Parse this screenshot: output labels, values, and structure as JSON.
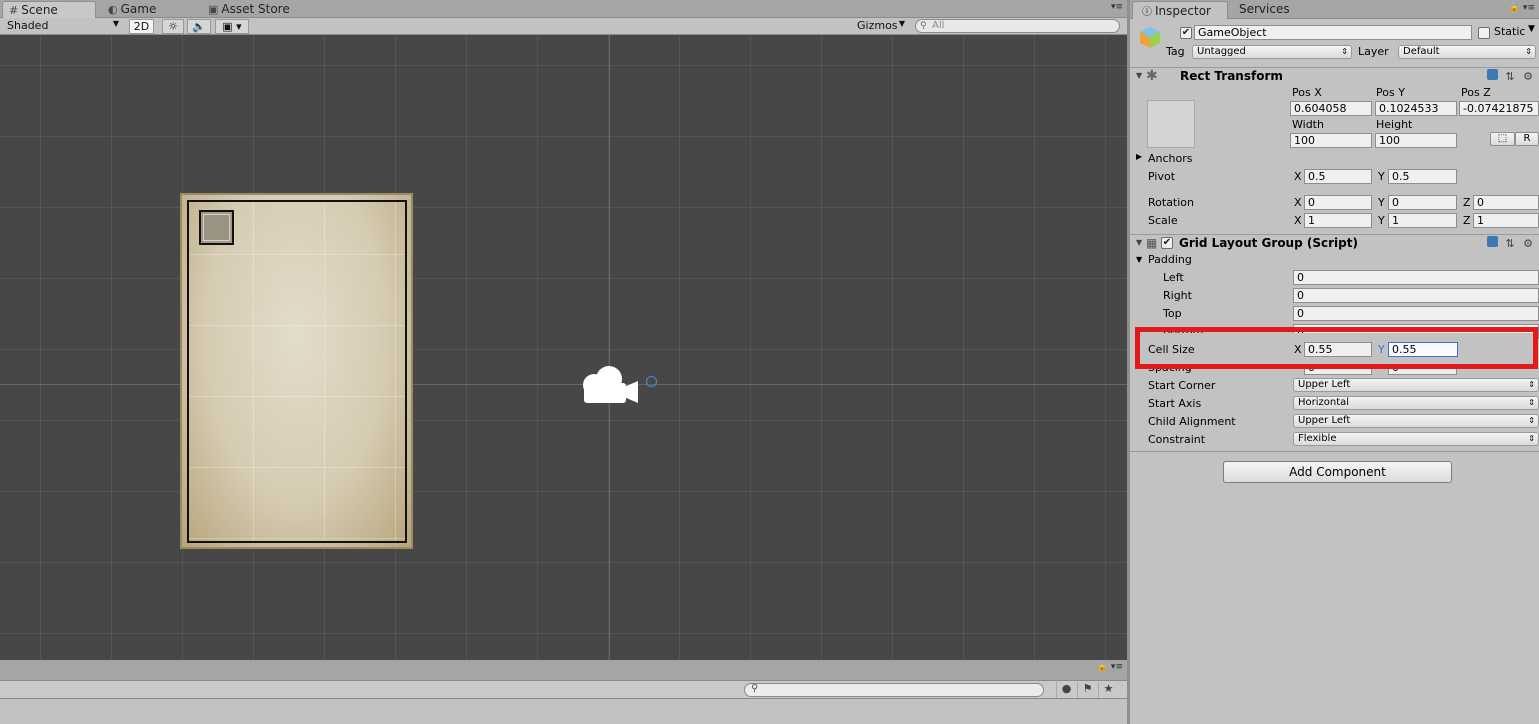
{
  "scene_tabs": [
    {
      "label": "Scene",
      "icon": "hash-icon"
    },
    {
      "label": "Game",
      "icon": "pacman-icon"
    },
    {
      "label": "Asset Store",
      "icon": "store-icon"
    }
  ],
  "scene_toolbar": {
    "shading_mode": "Shaded",
    "mode_2d": "2D",
    "gizmos_label": "Gizmos",
    "search_placeholder": "All"
  },
  "inspector_tabs": [
    {
      "label": "Inspector",
      "icon": "info-icon"
    },
    {
      "label": "Services"
    }
  ],
  "gameobject": {
    "name": "GameObject",
    "active": true,
    "static_label": "Static",
    "tag_label": "Tag",
    "tag_value": "Untagged",
    "layer_label": "Layer",
    "layer_value": "Default"
  },
  "rect_transform": {
    "title": "Rect Transform",
    "pos_x_label": "Pos X",
    "pos_x": "0.604058",
    "pos_y_label": "Pos Y",
    "pos_y": "0.1024533",
    "pos_z_label": "Pos Z",
    "pos_z": "-0.07421875",
    "width_label": "Width",
    "width": "100",
    "height_label": "Height",
    "height": "100",
    "r_button": "R",
    "anchors_label": "Anchors",
    "pivot_label": "Pivot",
    "pivot_x": "0.5",
    "pivot_y": "0.5",
    "rotation_label": "Rotation",
    "rot_x": "0",
    "rot_y": "0",
    "rot_z": "0",
    "scale_label": "Scale",
    "scale_x": "1",
    "scale_y": "1",
    "scale_z": "1",
    "x": "X",
    "y": "Y",
    "z": "Z"
  },
  "grid_layout": {
    "title": "Grid Layout Group (Script)",
    "enabled": true,
    "padding_label": "Padding",
    "left_label": "Left",
    "left": "0",
    "right_label": "Right",
    "right": "0",
    "top_label": "Top",
    "top": "0",
    "bottom_label": "Bottom",
    "bottom": "0",
    "cell_size_label": "Cell Size",
    "cell_x": "0.55",
    "cell_y": "0.55",
    "spacing_label": "Spacing",
    "spacing_x": "0",
    "spacing_y": "0",
    "start_corner_label": "Start Corner",
    "start_corner": "Upper Left",
    "start_axis_label": "Start Axis",
    "start_axis": "Horizontal",
    "child_alignment_label": "Child Alignment",
    "child_alignment": "Upper Left",
    "constraint_label": "Constraint",
    "constraint": "Flexible"
  },
  "add_component": "Add Component",
  "colors": {
    "viewport_bg": "#474747",
    "highlight": "#e11b1b",
    "panel_bg": "#c2c2c2"
  }
}
